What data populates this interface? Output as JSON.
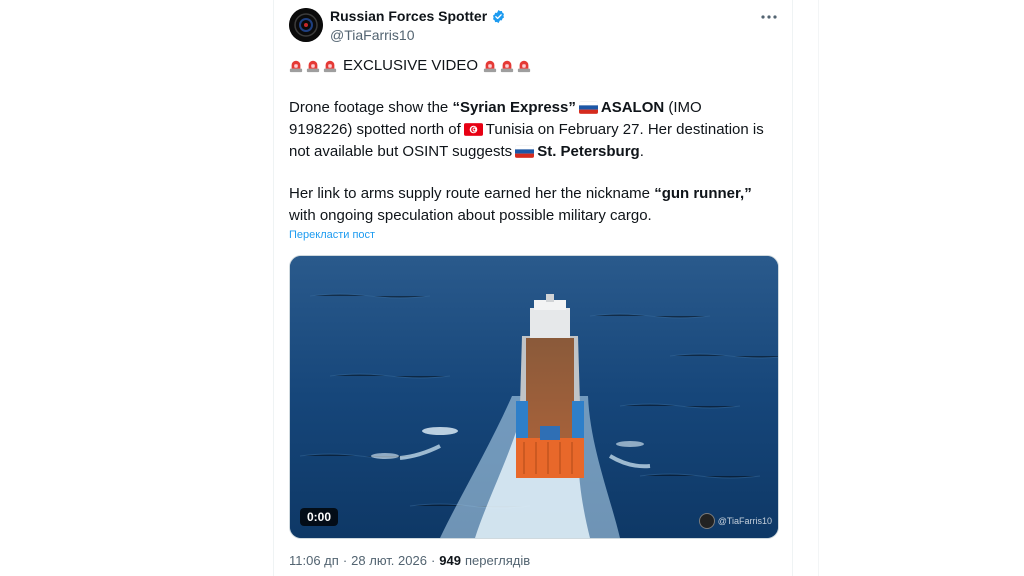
{
  "account": {
    "display_name": "Russian Forces Spotter",
    "handle": "@TiaFarris10",
    "verified": true,
    "avatar_icon": "dark-circle-avatar-icon"
  },
  "more_icon": "more-horizontal-icon",
  "tweet": {
    "headline": "EXCLUSIVE VIDEO",
    "alarm_icon": "rotating-light-emoji",
    "p1_t1": "Drone footage show the ",
    "p1_b1": "“Syrian Express”",
    "p1_b2": "ASALON",
    "p1_t2": " (IMO 9198226) spotted north of",
    "p1_t3": "Tunisia on February 27. Her destination is not available but OSINT suggests",
    "p1_b3": "St. Petersburg",
    "p1_t4": ".",
    "p2_t1": "Her link to arms supply route earned her the nickname ",
    "p2_b1": "“gun runner,”",
    "p2_t2": " with ongoing speculation about possible military cargo.",
    "translate_label": "Перекласти пост"
  },
  "media": {
    "duration": "0:00",
    "watermark": "@TiaFarris10"
  },
  "meta": {
    "time": "11:06 дп",
    "separator": "·",
    "date": "28 лют. 2026",
    "views_count": "949",
    "views_label": "переглядів"
  },
  "colors": {
    "accent": "#1d9bf0",
    "text": "#0f1419",
    "secondary": "#536471",
    "sea": "#16467a",
    "ship_orange": "#e8682a"
  }
}
